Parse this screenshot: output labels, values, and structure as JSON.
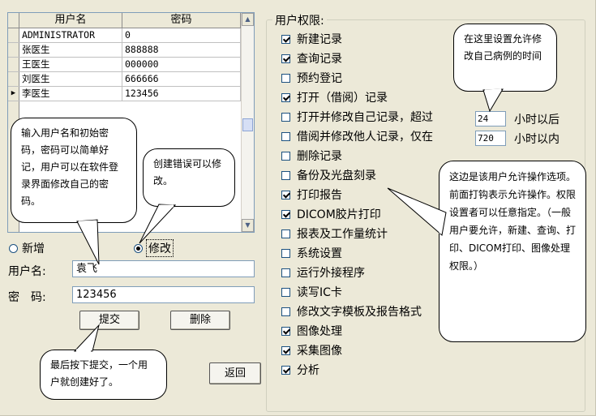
{
  "grid": {
    "headers": {
      "name": "用户名",
      "password": "密码"
    },
    "rows": [
      {
        "name": "ADMINISTRATOR",
        "password": "0",
        "current": false
      },
      {
        "name": "张医生",
        "password": "888888",
        "current": false
      },
      {
        "name": "王医生",
        "password": "000000",
        "current": false
      },
      {
        "name": "刘医生",
        "password": "666666",
        "current": false
      },
      {
        "name": "李医生",
        "password": "123456",
        "current": true
      }
    ],
    "current_row_marker": "▶"
  },
  "mode": {
    "add_label": "新增",
    "edit_label": "修改",
    "selected": "edit"
  },
  "form": {
    "username_label": "用户名:",
    "username_value": "袁飞",
    "password_label": "密　码:",
    "password_value": "123456",
    "submit_label": "提交",
    "delete_label": "删除",
    "back_label": "返回"
  },
  "permissions": {
    "title": "用户权限:",
    "items": [
      {
        "label": "新建记录",
        "checked": true
      },
      {
        "label": "查询记录",
        "checked": true
      },
      {
        "label": "预约登记",
        "checked": false
      },
      {
        "label": "打开（借阅）记录",
        "checked": true
      },
      {
        "label": "打开并修改自己记录，超过",
        "checked": false
      },
      {
        "label": "借阅并修改他人记录，仅在",
        "checked": false
      },
      {
        "label": "删除记录",
        "checked": false
      },
      {
        "label": "备份及光盘刻录",
        "checked": false
      },
      {
        "label": "打印报告",
        "checked": true
      },
      {
        "label": "DICOM胶片打印",
        "checked": true
      },
      {
        "label": "报表及工作量统计",
        "checked": false
      },
      {
        "label": "系统设置",
        "checked": false
      },
      {
        "label": "运行外接程序",
        "checked": false
      },
      {
        "label": "读写IC卡",
        "checked": false
      },
      {
        "label": "修改文字模板及报告格式",
        "checked": false
      },
      {
        "label": "图像处理",
        "checked": true
      },
      {
        "label": "采集图像",
        "checked": true
      },
      {
        "label": "分析",
        "checked": true
      }
    ],
    "own_edit_hours": "24",
    "own_edit_unit": "小时以后",
    "other_edit_hours": "720",
    "other_edit_unit": "小时以内"
  },
  "callouts": {
    "input_hint": "输入用户名和初始密码，密码可以简单好记，用户可以在软件登录界面修改自己的密码。",
    "edit_hint": "创建错误可以修改。",
    "submit_hint": "最后按下提交，一个用户就创建好了。",
    "time_hint": "在这里设置允许修改自己病例的时间",
    "perm_hint": "这边是该用户允许操作选项。前面打钩表示允许操作。权限设置者可以任意指定。（一般用户要允许，新建、查询、打印、DICOM打印、图像处理权限。）"
  },
  "colors": {
    "dialog_bg": "#ece9d8",
    "field_border": "#7f9db9"
  }
}
